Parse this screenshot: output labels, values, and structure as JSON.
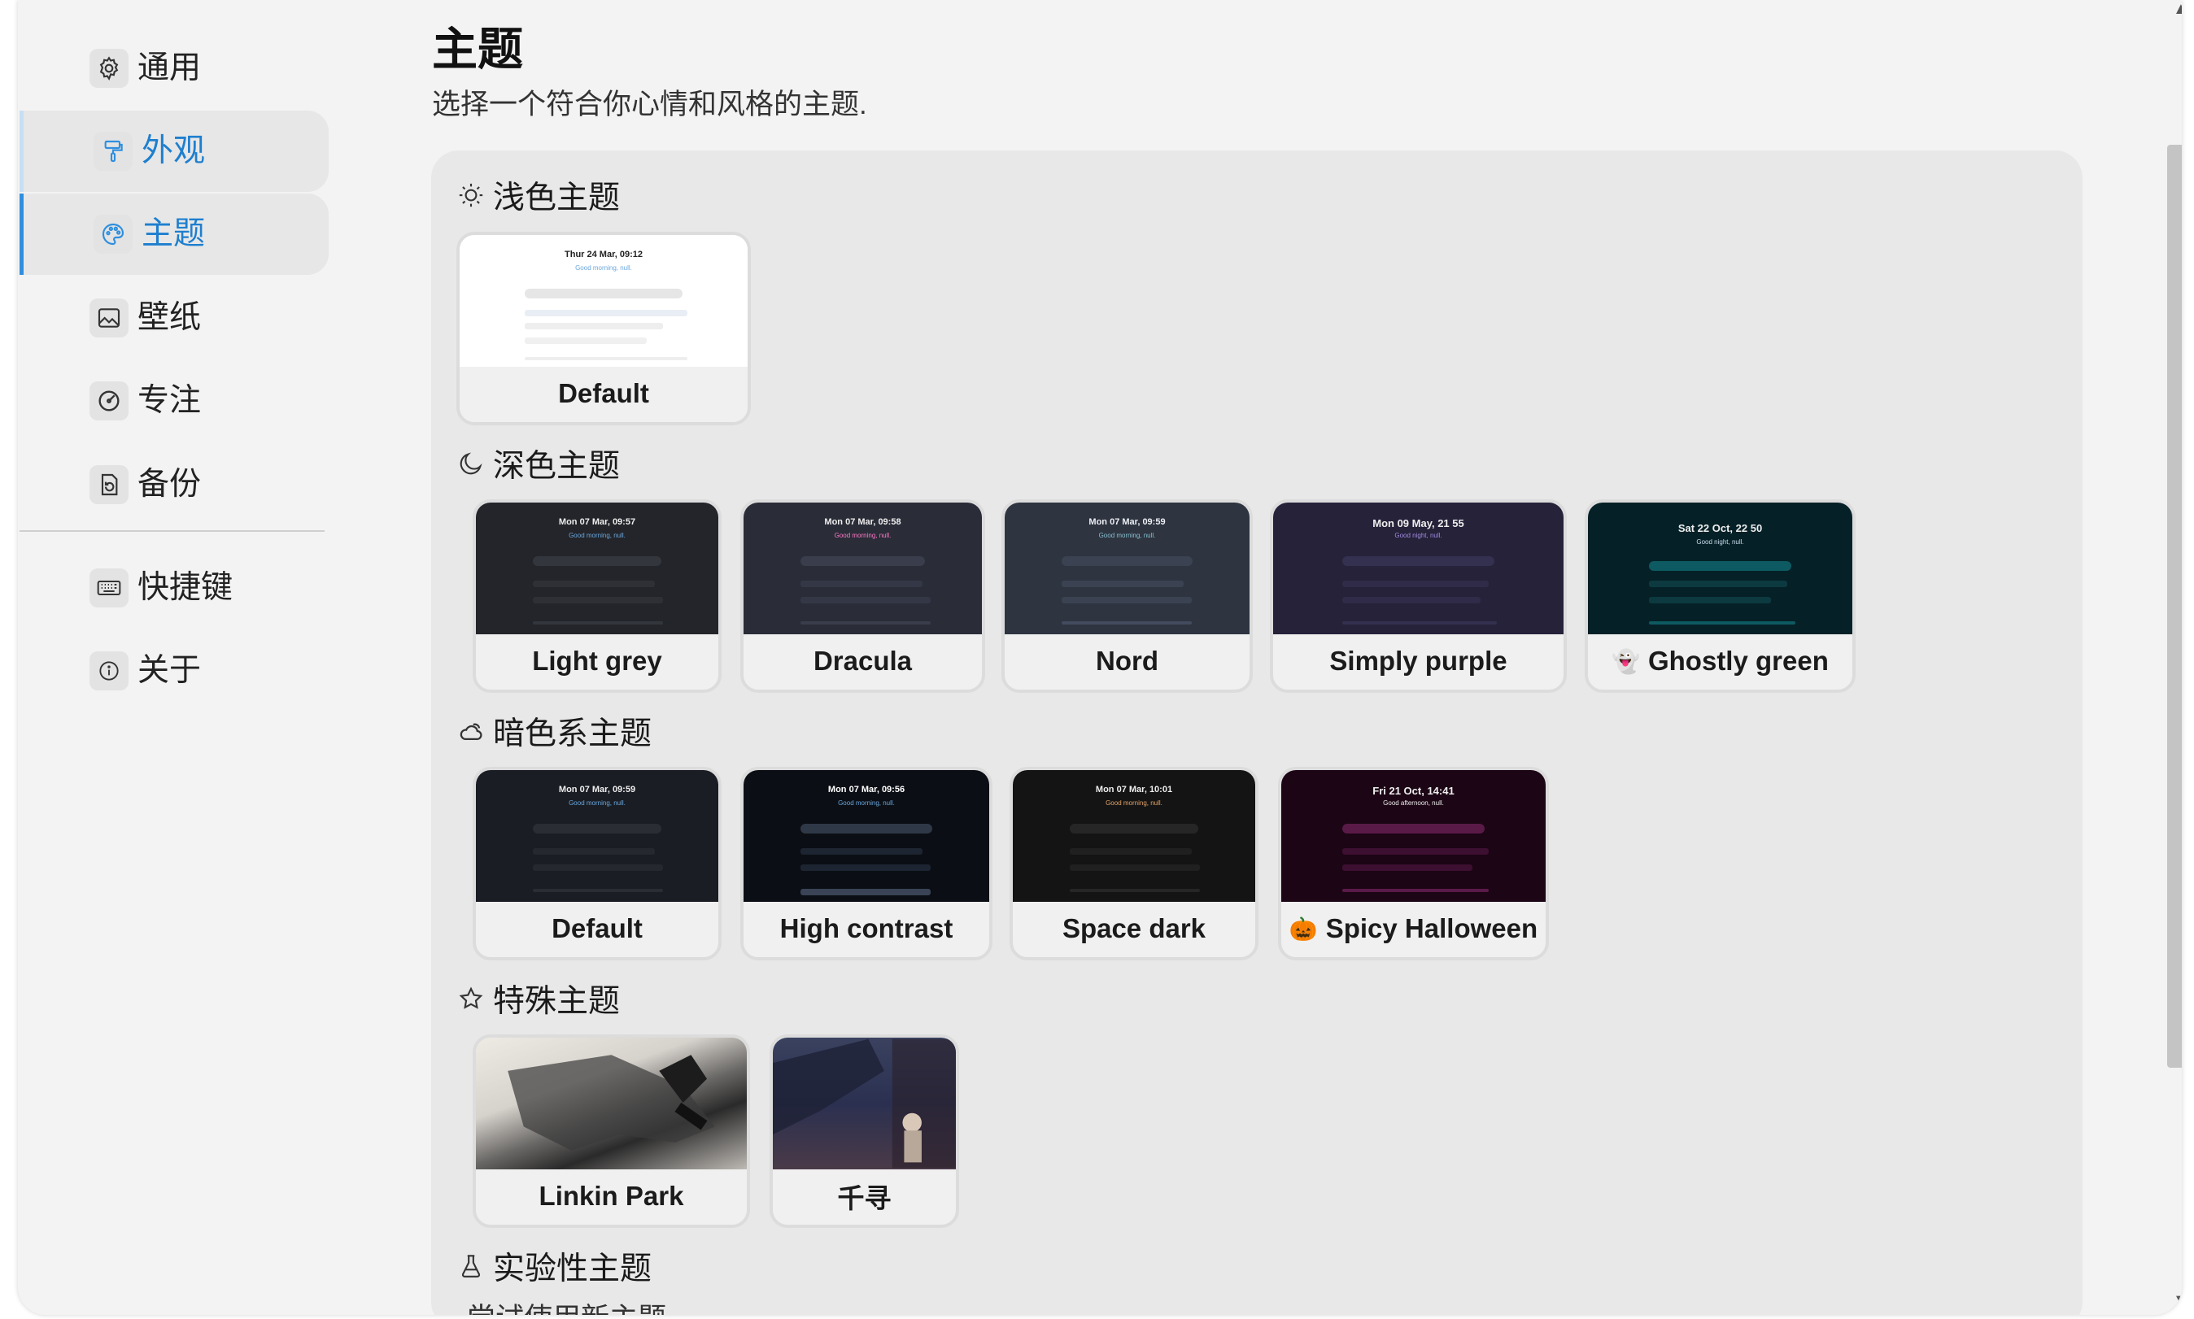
{
  "sidebar": {
    "items": [
      {
        "label": "通用",
        "icon": "gear-icon"
      },
      {
        "label": "外观",
        "icon": "paint-roller-icon"
      },
      {
        "label": "主题",
        "icon": "palette-icon"
      },
      {
        "label": "壁纸",
        "icon": "image-icon"
      },
      {
        "label": "专注",
        "icon": "target-icon"
      },
      {
        "label": "备份",
        "icon": "backup-icon"
      },
      {
        "label": "快捷键",
        "icon": "keyboard-icon"
      },
      {
        "label": "关于",
        "icon": "info-icon"
      }
    ],
    "active": "主题",
    "accent_color": "#2f8fdf"
  },
  "header": {
    "title": "主题",
    "subtitle": "选择一个符合你心情和风格的主题."
  },
  "sections": {
    "light": {
      "title": "浅色主题",
      "icon": "sun-icon",
      "themes": [
        {
          "name": "Default",
          "preview_date": "Thur 24 Mar, 09:12",
          "preview_greeting": "Good morning, null."
        }
      ]
    },
    "dark": {
      "title": "深色主题",
      "icon": "moon-icon",
      "themes": [
        {
          "name": "Light grey",
          "preview_date": "Mon 07 Mar, 09:57",
          "preview_greeting": "Good morning, null."
        },
        {
          "name": "Dracula",
          "preview_date": "Mon 07 Mar, 09:58",
          "preview_greeting": "Good morning, null."
        },
        {
          "name": "Nord",
          "preview_date": "Mon 07 Mar, 09:59",
          "preview_greeting": "Good morning, null."
        },
        {
          "name": "Simply purple",
          "preview_date": "Mon 09 May, 21 55",
          "preview_greeting": "Good night, null."
        },
        {
          "name": "Ghostly green",
          "preview_date": "Sat 22 Oct, 22 50",
          "preview_greeting": "Good night, null.",
          "emoji": "👻"
        }
      ]
    },
    "dim": {
      "title": "暗色系主题",
      "icon": "cloud-moon-icon",
      "themes": [
        {
          "name": "Default",
          "preview_date": "Mon 07 Mar, 09:59",
          "preview_greeting": "Good morning, null."
        },
        {
          "name": "High contrast",
          "preview_date": "Mon 07 Mar, 09:56",
          "preview_greeting": "Good morning, null."
        },
        {
          "name": "Space dark",
          "preview_date": "Mon 07 Mar, 10:01",
          "preview_greeting": "Good morning, null."
        },
        {
          "name": "Spicy Halloween",
          "preview_date": "Fri 21 Oct, 14:41",
          "preview_greeting": "Good afternoon, null.",
          "emoji": "🎃"
        }
      ]
    },
    "special": {
      "title": "特殊主题",
      "icon": "star-icon",
      "themes": [
        {
          "name": "Linkin Park"
        },
        {
          "name": "千寻"
        }
      ]
    },
    "experimental": {
      "title": "实验性主题",
      "icon": "flask-icon",
      "subtitle": "尝试使用新主题"
    }
  }
}
